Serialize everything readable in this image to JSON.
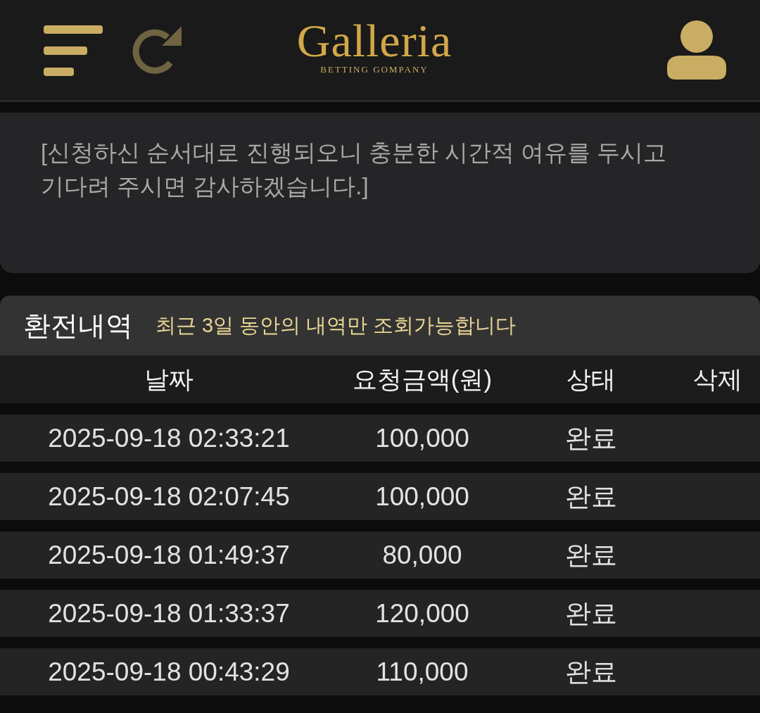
{
  "header": {
    "logo": {
      "title": "Galleria",
      "subtitle": "BETTING GOMPANY"
    }
  },
  "notice": {
    "text": "[신청하신 순서대로 진행되오니 충분한 시간적 여유를 두시고 기다려 주시면 감사하겠습니다.]"
  },
  "history": {
    "title": "환전내역",
    "note": "최근 3일 동안의 내역만 조회가능합니다",
    "table": {
      "columns": [
        "날짜",
        "요청금액(원)",
        "상태",
        "삭제"
      ],
      "rows": [
        {
          "date": "2025-09-18 02:33:21",
          "amount": "100,000",
          "status": "완료"
        },
        {
          "date": "2025-09-18 02:07:45",
          "amount": "100,000",
          "status": "완료"
        },
        {
          "date": "2025-09-18 01:49:37",
          "amount": "80,000",
          "status": "완료"
        },
        {
          "date": "2025-09-18 01:33:37",
          "amount": "120,000",
          "status": "완료"
        },
        {
          "date": "2025-09-18 00:43:29",
          "amount": "110,000",
          "status": "완료"
        }
      ]
    }
  }
}
